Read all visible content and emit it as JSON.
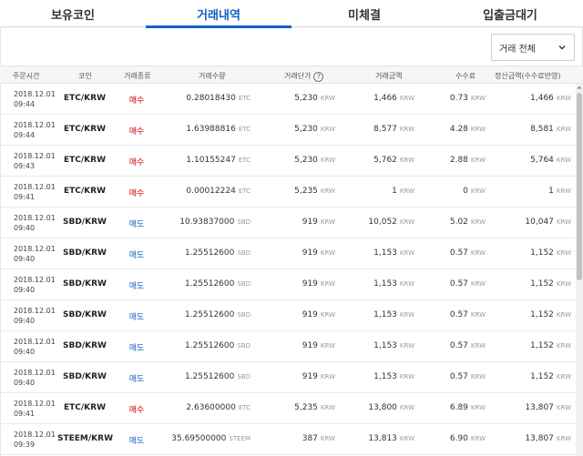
{
  "tabs": [
    {
      "label": "보유코인",
      "active": false
    },
    {
      "label": "거래내역",
      "active": true
    },
    {
      "label": "미체결",
      "active": false
    },
    {
      "label": "입출금대기",
      "active": false
    }
  ],
  "filter": {
    "selected": "거래 전체",
    "icon": "chevron-down-icon"
  },
  "columns": {
    "time": "주문시간",
    "coin": "코인",
    "type": "거래종류",
    "qty": "거래수량",
    "price": "거래단가",
    "price_help": "?",
    "amount": "거래금액",
    "fee": "수수료",
    "settle": "정산금액(수수료반영)"
  },
  "rows": [
    {
      "date": "2018.12.01",
      "time": "09:44",
      "coin": "ETC/KRW",
      "type": "매수",
      "side": "buy",
      "qty": "0.28018430",
      "qty_unit": "ETC",
      "price": "5,230",
      "price_unit": "KRW",
      "amount": "1,466",
      "amount_unit": "KRW",
      "fee": "0.73",
      "fee_unit": "KRW",
      "settle": "1,466",
      "settle_unit": "KRW"
    },
    {
      "date": "2018.12.01",
      "time": "09:44",
      "coin": "ETC/KRW",
      "type": "매수",
      "side": "buy",
      "qty": "1.63988816",
      "qty_unit": "ETC",
      "price": "5,230",
      "price_unit": "KRW",
      "amount": "8,577",
      "amount_unit": "KRW",
      "fee": "4.28",
      "fee_unit": "KRW",
      "settle": "8,581",
      "settle_unit": "KRW"
    },
    {
      "date": "2018.12.01",
      "time": "09:43",
      "coin": "ETC/KRW",
      "type": "매수",
      "side": "buy",
      "qty": "1.10155247",
      "qty_unit": "ETC",
      "price": "5,230",
      "price_unit": "KRW",
      "amount": "5,762",
      "amount_unit": "KRW",
      "fee": "2.88",
      "fee_unit": "KRW",
      "settle": "5,764",
      "settle_unit": "KRW"
    },
    {
      "date": "2018.12.01",
      "time": "09:41",
      "coin": "ETC/KRW",
      "type": "매수",
      "side": "buy",
      "qty": "0.00012224",
      "qty_unit": "ETC",
      "price": "5,235",
      "price_unit": "KRW",
      "amount": "1",
      "amount_unit": "KRW",
      "fee": "0",
      "fee_unit": "KRW",
      "settle": "1",
      "settle_unit": "KRW"
    },
    {
      "date": "2018.12.01",
      "time": "09:40",
      "coin": "SBD/KRW",
      "type": "매도",
      "side": "sell",
      "qty": "10.93837000",
      "qty_unit": "SBD",
      "price": "919",
      "price_unit": "KRW",
      "amount": "10,052",
      "amount_unit": "KRW",
      "fee": "5.02",
      "fee_unit": "KRW",
      "settle": "10,047",
      "settle_unit": "KRW"
    },
    {
      "date": "2018.12.01",
      "time": "09:40",
      "coin": "SBD/KRW",
      "type": "매도",
      "side": "sell",
      "qty": "1.25512600",
      "qty_unit": "SBD",
      "price": "919",
      "price_unit": "KRW",
      "amount": "1,153",
      "amount_unit": "KRW",
      "fee": "0.57",
      "fee_unit": "KRW",
      "settle": "1,152",
      "settle_unit": "KRW"
    },
    {
      "date": "2018.12.01",
      "time": "09:40",
      "coin": "SBD/KRW",
      "type": "매도",
      "side": "sell",
      "qty": "1.25512600",
      "qty_unit": "SBD",
      "price": "919",
      "price_unit": "KRW",
      "amount": "1,153",
      "amount_unit": "KRW",
      "fee": "0.57",
      "fee_unit": "KRW",
      "settle": "1,152",
      "settle_unit": "KRW"
    },
    {
      "date": "2018.12.01",
      "time": "09:40",
      "coin": "SBD/KRW",
      "type": "매도",
      "side": "sell",
      "qty": "1.25512600",
      "qty_unit": "SBD",
      "price": "919",
      "price_unit": "KRW",
      "amount": "1,153",
      "amount_unit": "KRW",
      "fee": "0.57",
      "fee_unit": "KRW",
      "settle": "1,152",
      "settle_unit": "KRW"
    },
    {
      "date": "2018.12.01",
      "time": "09:40",
      "coin": "SBD/KRW",
      "type": "매도",
      "side": "sell",
      "qty": "1.25512600",
      "qty_unit": "SBD",
      "price": "919",
      "price_unit": "KRW",
      "amount": "1,153",
      "amount_unit": "KRW",
      "fee": "0.57",
      "fee_unit": "KRW",
      "settle": "1,152",
      "settle_unit": "KRW"
    },
    {
      "date": "2018.12.01",
      "time": "09:40",
      "coin": "SBD/KRW",
      "type": "매도",
      "side": "sell",
      "qty": "1.25512600",
      "qty_unit": "SBD",
      "price": "919",
      "price_unit": "KRW",
      "amount": "1,153",
      "amount_unit": "KRW",
      "fee": "0.57",
      "fee_unit": "KRW",
      "settle": "1,152",
      "settle_unit": "KRW"
    },
    {
      "date": "2018.12.01",
      "time": "09:41",
      "coin": "ETC/KRW",
      "type": "매수",
      "side": "buy",
      "qty": "2.63600000",
      "qty_unit": "ETC",
      "price": "5,235",
      "price_unit": "KRW",
      "amount": "13,800",
      "amount_unit": "KRW",
      "fee": "6.89",
      "fee_unit": "KRW",
      "settle": "13,807",
      "settle_unit": "KRW"
    },
    {
      "date": "2018.12.01",
      "time": "09:39",
      "coin": "STEEM/KRW",
      "type": "매도",
      "side": "sell",
      "qty": "35.69500000",
      "qty_unit": "STEEM",
      "price": "387",
      "price_unit": "KRW",
      "amount": "13,813",
      "amount_unit": "KRW",
      "fee": "6.90",
      "fee_unit": "KRW",
      "settle": "13,807",
      "settle_unit": "KRW"
    }
  ]
}
